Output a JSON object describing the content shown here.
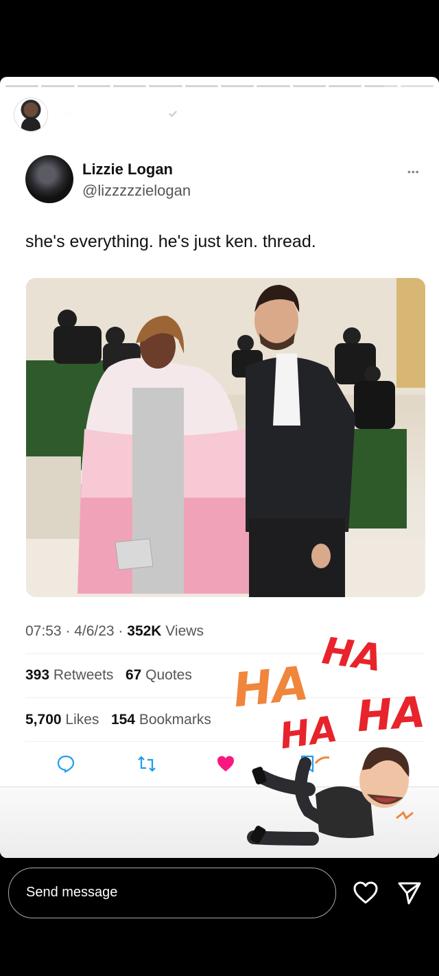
{
  "story": {
    "username": "alexisohanian",
    "time": "10m",
    "segments": 12
  },
  "tweet": {
    "name": "Lizzie Logan",
    "handle": "@lizzzzzielogan",
    "text": "she's everything. he's just ken. thread.",
    "timestamp": "07:53 · 4/6/23 · ",
    "views_count": "352K",
    "views_label": " Views",
    "retweets_count": "393",
    "retweets_label": " Retweets",
    "quotes_count": "67",
    "quotes_label": " Quotes",
    "likes_count": "5,700",
    "likes_label": " Likes",
    "bookmarks_count": "154",
    "bookmarks_label": " Bookmarks"
  },
  "sticker": {
    "ha1": "HA",
    "ha2": "HA",
    "ha3": "HA",
    "ha4": "HA"
  },
  "footer": {
    "send_placeholder": "Send message"
  },
  "colors": {
    "like": "#f91880",
    "ha_red": "#e8232b",
    "ha_orange": "#f0853c"
  }
}
